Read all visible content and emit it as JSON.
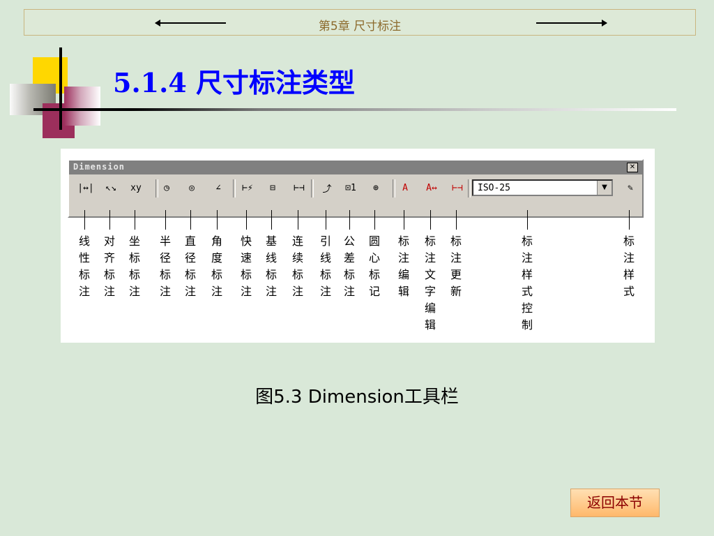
{
  "header": {
    "chapter_title": "第5章  尺寸标注"
  },
  "section": {
    "title": "5.1.4  尺寸标注类型"
  },
  "toolbar_window": {
    "title": "Dimension",
    "close_glyph": "✕",
    "buttons": [
      {
        "glyph": "|↔|",
        "label": "线\n性\n标\n注"
      },
      {
        "glyph": "↖↘",
        "label": "对\n齐\n标\n注"
      },
      {
        "glyph": "xy",
        "label": "坐\n标\n标\n注"
      },
      {
        "glyph": "◷",
        "label": "半\n径\n标\n注"
      },
      {
        "glyph": "◎",
        "label": "直\n径\n标\n注"
      },
      {
        "glyph": "∠",
        "label": "角\n度\n标\n注"
      },
      {
        "glyph": "⊢⚡",
        "label": "快\n速\n标\n注"
      },
      {
        "glyph": "⊟",
        "label": "基\n线\n标\n注"
      },
      {
        "glyph": "⊢⊣",
        "label": "连\n续\n标\n注"
      },
      {
        "glyph": "⤴",
        "label": "引\n线\n标\n注"
      },
      {
        "glyph": "⊡1",
        "label": "公\n差\n标\n注"
      },
      {
        "glyph": "⊕",
        "label": "圆\n心\n标\n记"
      },
      {
        "glyph": "A",
        "label": "标\n注\n编\n辑"
      },
      {
        "glyph": "A↔",
        "label": "标\n注\n文\n字\n编\n辑"
      },
      {
        "glyph": "⊢⊣",
        "label": "标\n注\n更\n新"
      }
    ],
    "style_combo": {
      "value": "ISO-25",
      "label": "标\n注\n样\n式\n控\n制"
    },
    "style_button": {
      "glyph": "✎",
      "label": "标\n注\n样\n式"
    }
  },
  "caption": "图5.3  Dimension工具栏",
  "nav": {
    "back_label": "返回本节"
  }
}
